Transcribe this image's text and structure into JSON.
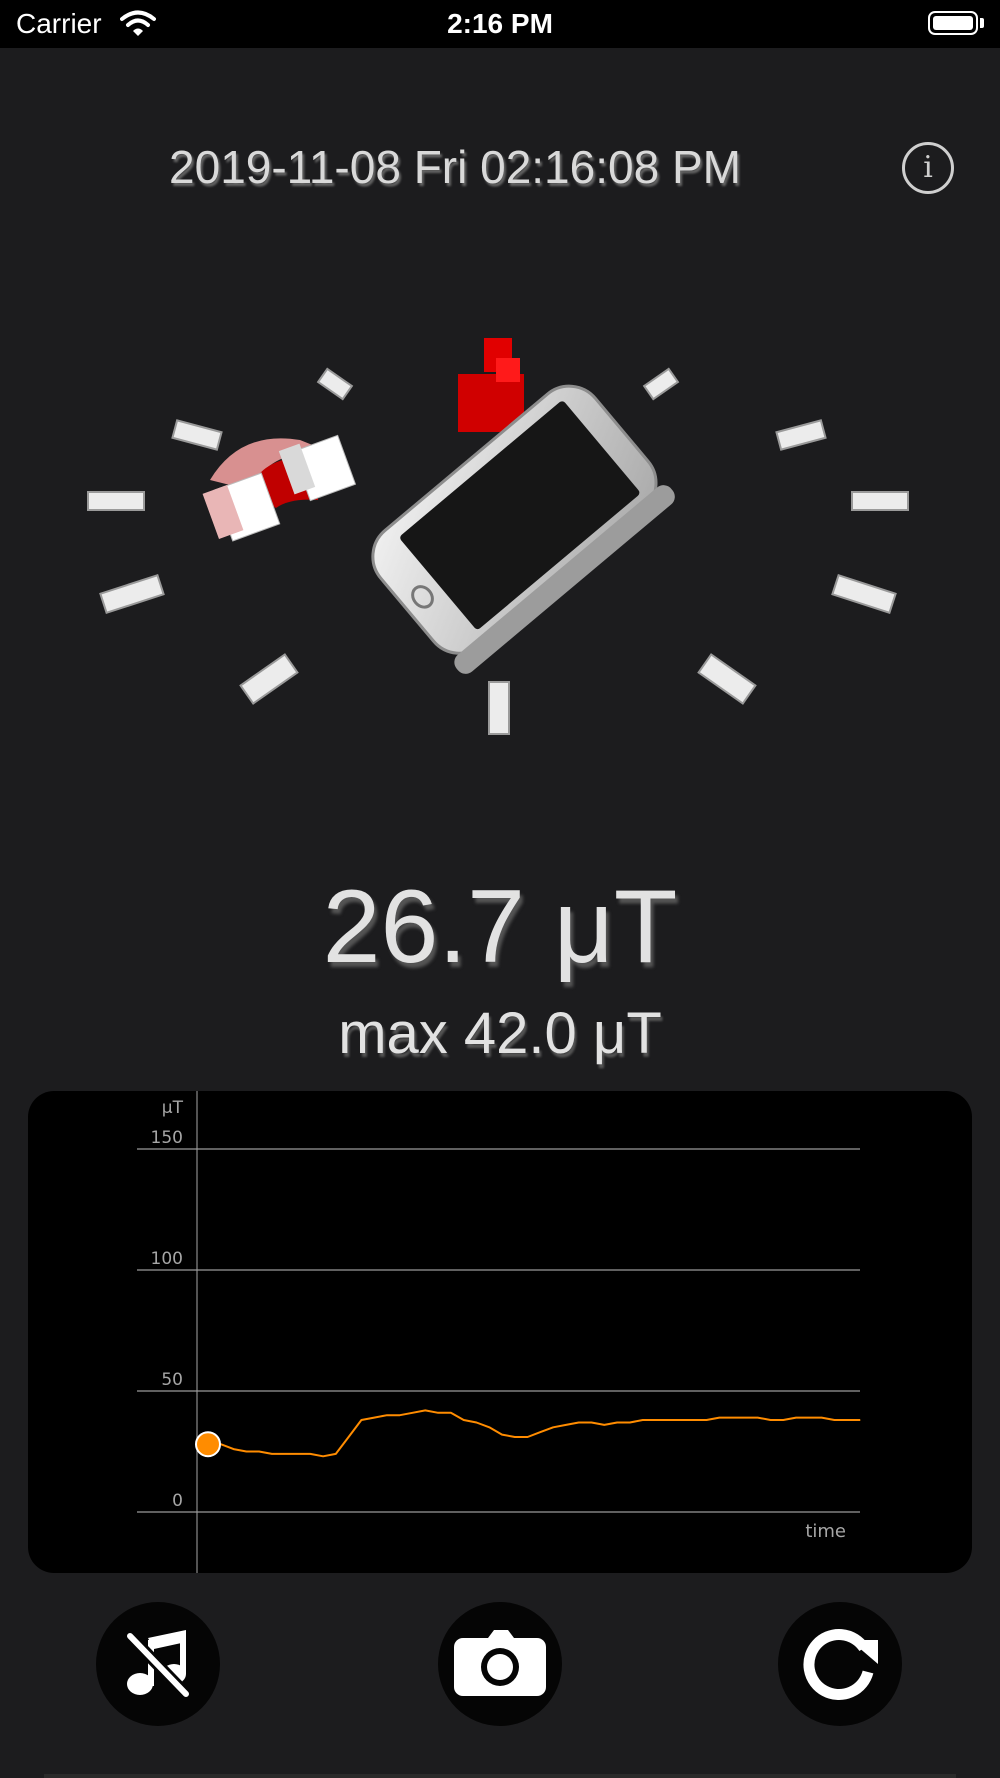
{
  "status_bar": {
    "carrier": "Carrier",
    "time": "2:16 PM",
    "wifi_icon": "wifi-icon",
    "battery_icon": "battery-full-icon"
  },
  "header": {
    "datetime": "2019-11-08 Fri 02:16:08 PM",
    "info_label": "i",
    "info_icon": "info-icon"
  },
  "readings": {
    "current": "26.7 μT",
    "max": "max 42.0 μT"
  },
  "colors": {
    "background": "#1c1c1e",
    "panel": "#000000",
    "accent_line": "#ff8c00",
    "magnet_red": "#e00000"
  },
  "chart_data": {
    "type": "line",
    "ylabel": "μT",
    "xlabel": "time",
    "ylim": [
      -25,
      150
    ],
    "yticks": [
      0,
      50,
      100,
      150
    ],
    "grid": true,
    "series": [
      {
        "color": "#ff8c00",
        "values": [
          28,
          28,
          26,
          25,
          25,
          24,
          24,
          24,
          24,
          23,
          24,
          31,
          38,
          39,
          40,
          40,
          41,
          42,
          41,
          41,
          38,
          37,
          35,
          32,
          31,
          31,
          33,
          35,
          36,
          37,
          37,
          36,
          37,
          37,
          38,
          38,
          38,
          38,
          38,
          38,
          39,
          39,
          39,
          39,
          38,
          38,
          39,
          39,
          39,
          38,
          38,
          38
        ]
      }
    ]
  },
  "controls": {
    "mute": "music-muted-icon",
    "camera": "camera-icon",
    "reset": "reset-icon"
  }
}
